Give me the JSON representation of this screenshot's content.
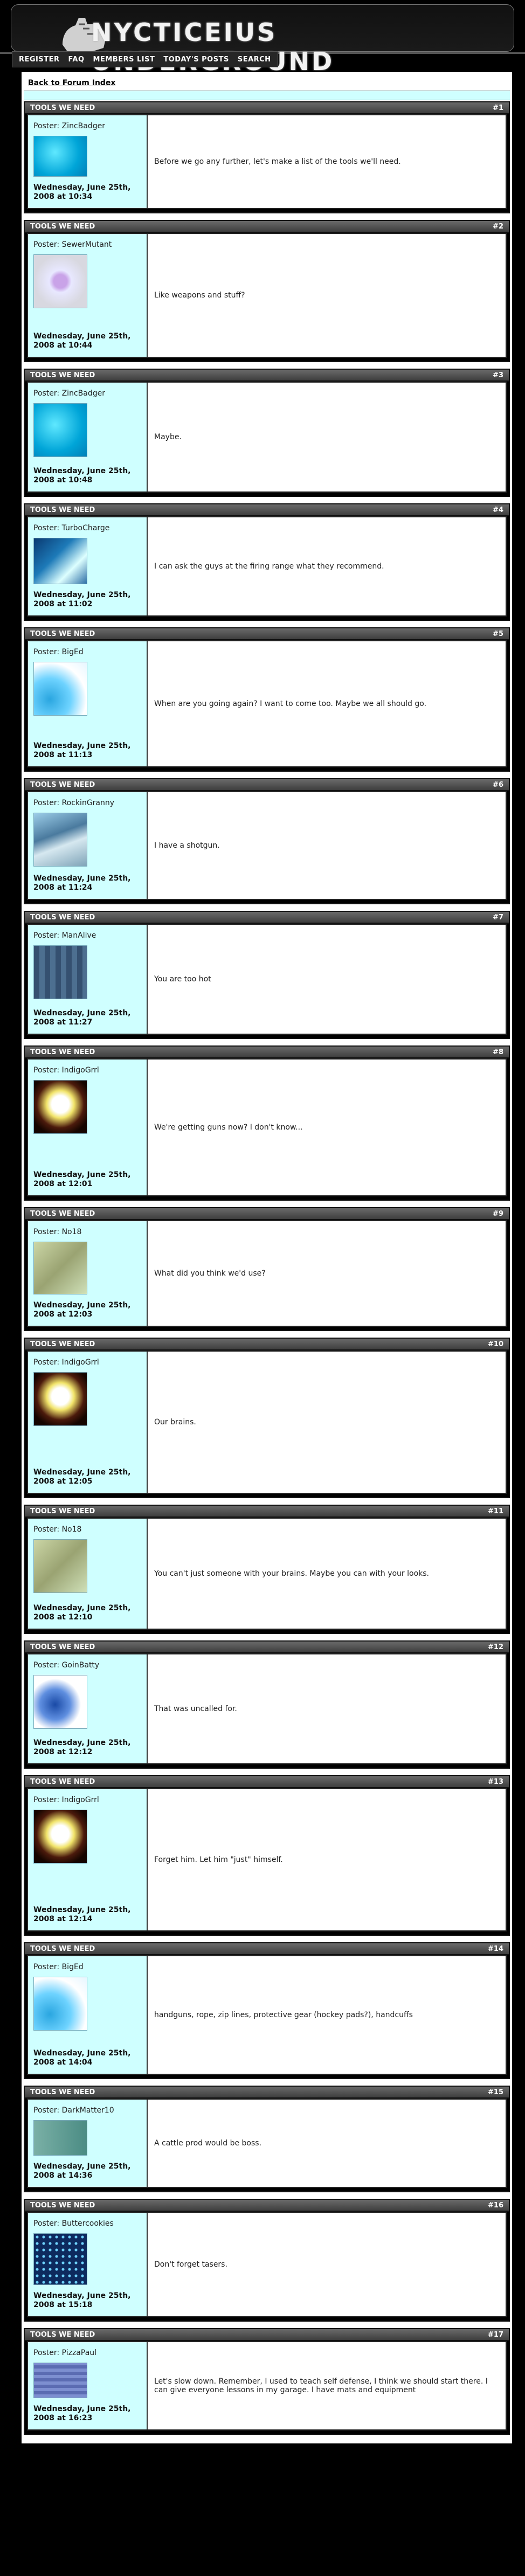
{
  "header": {
    "title": "NYCTICEIUS UNDERGROUND",
    "nav": [
      "REGISTER",
      "FAQ",
      "MEMBERS LIST",
      "TODAY'S POSTS",
      "SEARCH"
    ]
  },
  "topic": {
    "back_link": "Back to Forum Index"
  },
  "posts": [
    {
      "title": "TOOLS WE NEED",
      "number": "#1",
      "poster": "Poster: ZincBadger",
      "date": "Wednesday, June 25th, 2008 at 10:34",
      "text": "Before we go any further, let's make a list of the tools we'll need.",
      "avatar": "cyan-square-avatar"
    },
    {
      "title": "TOOLS WE NEED",
      "number": "#2",
      "poster": "Poster: SewerMutant",
      "date": "Wednesday, June 25th, 2008 at 10:44",
      "text": "Like weapons and stuff?",
      "avatar": "purple-orb-avatar"
    },
    {
      "title": "TOOLS WE NEED",
      "number": "#3",
      "poster": "Poster: ZincBadger",
      "date": "Wednesday, June 25th, 2008 at 10:48",
      "text": "Maybe.",
      "avatar": "cyan-square-avatar"
    },
    {
      "title": "TOOLS WE NEED",
      "number": "#4",
      "poster": "Poster: TurboCharge",
      "date": "Wednesday, June 25th, 2008 at 11:02",
      "text": "I can ask the guys at the firing range what they recommend.",
      "avatar": "blue-photo-avatar"
    },
    {
      "title": "TOOLS WE NEED",
      "number": "#5",
      "poster": "Poster: BigEd",
      "date": "Wednesday, June 25th, 2008 at 11:13",
      "text": "When are you going again? I want to come too. Maybe we all should go.",
      "avatar": "splash-avatar"
    },
    {
      "title": "TOOLS WE NEED",
      "number": "#6",
      "poster": "Poster: RockinGranny",
      "date": "Wednesday, June 25th, 2008 at 11:24",
      "text": "I have a shotgun.",
      "avatar": "hand-avatar"
    },
    {
      "title": "TOOLS WE NEED",
      "number": "#7",
      "poster": "Poster: ManAlive",
      "date": "Wednesday, June 25th, 2008 at 11:27",
      "text": "You are too hot",
      "avatar": "tiles-avatar"
    },
    {
      "title": "TOOLS WE NEED",
      "number": "#8",
      "poster": "Poster: IndigoGrrl",
      "date": "Wednesday, June 25th, 2008 at 12:01",
      "text": "We're getting guns now? I don't know...",
      "avatar": "face-avatar"
    },
    {
      "title": "TOOLS WE NEED",
      "number": "#9",
      "poster": "Poster: No18",
      "date": "Wednesday, June 25th, 2008 at 12:03",
      "text": "What did you think we'd use?",
      "avatar": "hands-avatar"
    },
    {
      "title": "TOOLS WE NEED",
      "number": "#10",
      "poster": "Poster: IndigoGrrl",
      "date": "Wednesday, June 25th, 2008 at 12:05",
      "text": "Our brains.",
      "avatar": "face-avatar"
    },
    {
      "title": "TOOLS WE NEED",
      "number": "#11",
      "poster": "Poster: No18",
      "date": "Wednesday, June 25th, 2008 at 12:10",
      "text": "You can't just someone with your brains. Maybe you can with your looks.",
      "avatar": "hands-avatar"
    },
    {
      "title": "TOOLS WE NEED",
      "number": "#12",
      "poster": "Poster: GoinBatty",
      "date": "Wednesday, June 25th, 2008 at 12:12",
      "text": "That was uncalled for.",
      "avatar": "glove-avatar"
    },
    {
      "title": "TOOLS WE NEED",
      "number": "#13",
      "poster": "Poster: IndigoGrrl",
      "date": "Wednesday, June 25th, 2008 at 12:14",
      "text": "Forget him. Let him \"just\" himself.",
      "avatar": "face-avatar"
    },
    {
      "title": "TOOLS WE NEED",
      "number": "#14",
      "poster": "Poster: BigEd",
      "date": "Wednesday, June 25th, 2008 at 14:04",
      "text": "handguns, rope, zip lines, protective gear (hockey pads?), handcuffs",
      "avatar": "splash-avatar"
    },
    {
      "title": "TOOLS WE NEED",
      "number": "#15",
      "poster": "Poster: DarkMatter10",
      "date": "Wednesday, June 25th, 2008 at 14:36",
      "text": "A cattle prod would be boss.",
      "avatar": "fence-avatar"
    },
    {
      "title": "TOOLS WE NEED",
      "number": "#16",
      "poster": "Poster: Buttercookies",
      "date": "Wednesday, June 25th, 2008 at 15:18",
      "text": "Don't forget tasers.",
      "avatar": "grid-avatar"
    },
    {
      "title": "TOOLS WE NEED",
      "number": "#17",
      "poster": "Poster: PizzaPaul",
      "date": "Wednesday, June 25th, 2008 at 16:23",
      "text": "Let's slow down. Remember, I used to teach self defense, I think we should start there. I can give everyone lessons in my garage. I have mats and equipment",
      "avatar": "mosaic-avatar"
    }
  ]
}
